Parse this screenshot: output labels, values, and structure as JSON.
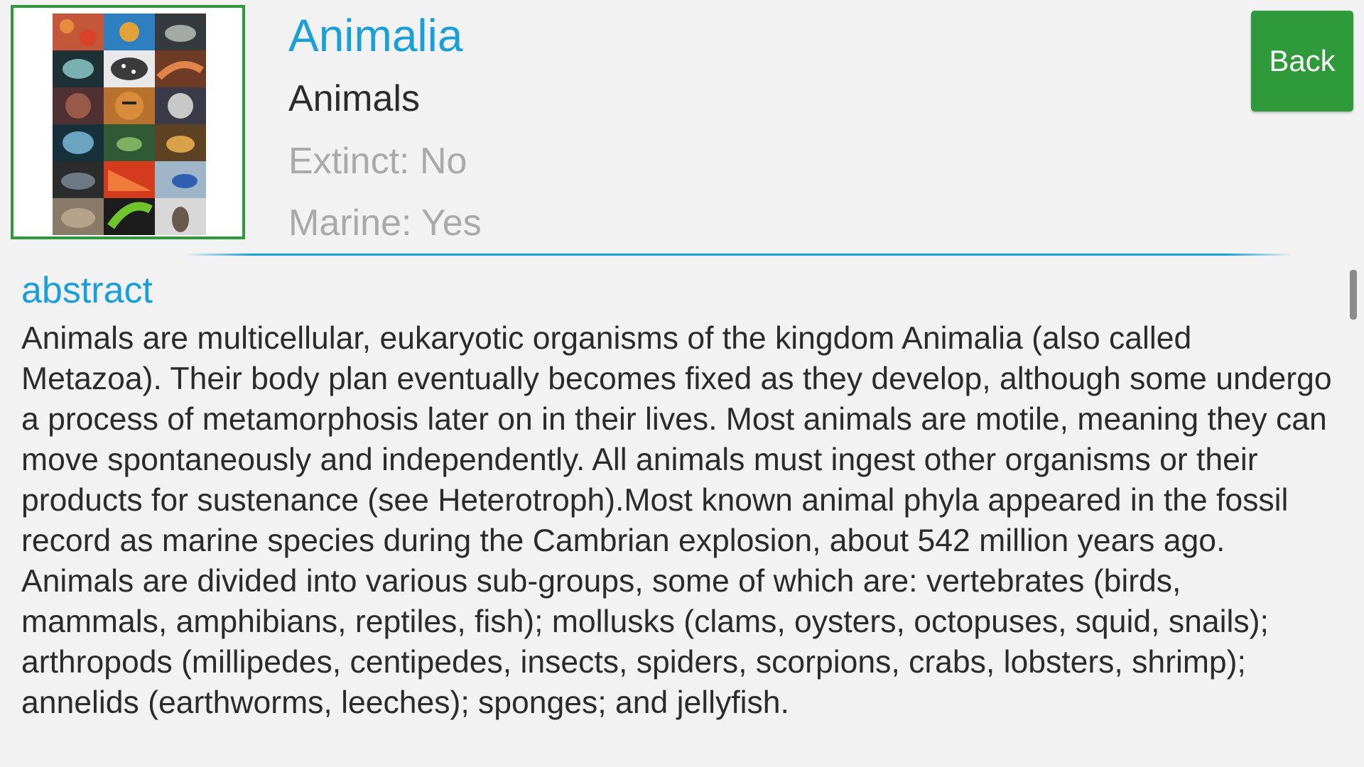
{
  "header": {
    "title": "Animalia",
    "subtitle": "Animals",
    "extinct": "Extinct: No",
    "marine": "Marine: Yes",
    "back_label": "Back",
    "thumbnail_icon": "animal-collage-image"
  },
  "colors": {
    "accent_blue": "#1a9fd8",
    "button_green": "#2e9a3a",
    "muted_text": "#a9a9a9",
    "body_text": "#2b2b2b"
  },
  "section": {
    "heading": "abstract",
    "body": "Animals are multicellular, eukaryotic organisms of the kingdom Animalia (also called Metazoa). Their body plan eventually becomes fixed as they develop, although some undergo a process of metamorphosis later on in their lives. Most animals are motile, meaning they can move spontaneously and independently. All animals must ingest other organisms or their products for sustenance (see Heterotroph).Most known animal phyla appeared in the fossil record as marine species during the Cambrian explosion, about 542 million years ago. Animals are divided into various sub-groups, some of which are: vertebrates (birds, mammals, amphibians, reptiles, fish); mollusks (clams, oysters, octopuses, squid, snails); arthropods (millipedes, centipedes, insects, spiders, scorpions, crabs, lobsters, shrimp); annelids (earthworms, leeches); sponges; and jellyfish."
  }
}
